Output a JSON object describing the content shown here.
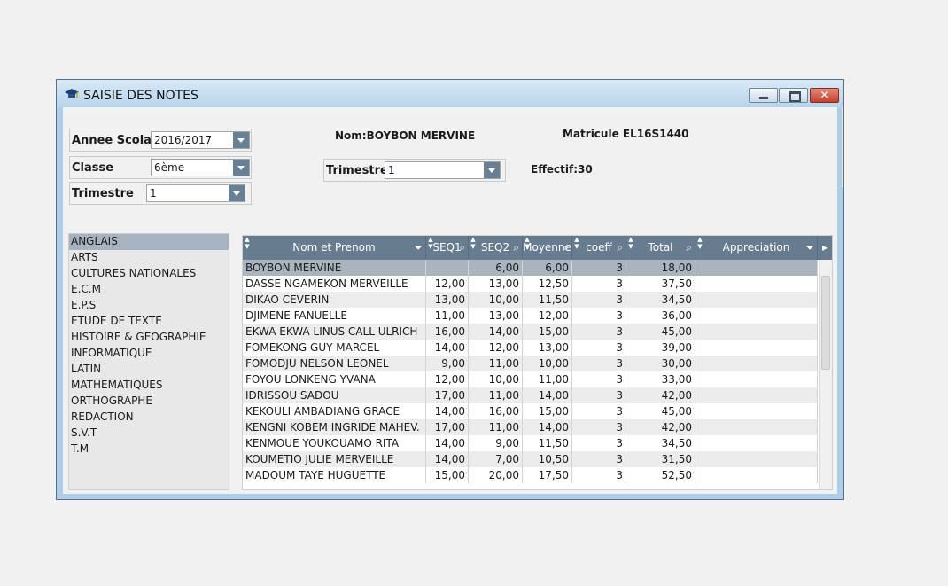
{
  "window": {
    "title": "SAISIE DES NOTES",
    "icon": "graduation-cap-icon",
    "close_glyph": "✕"
  },
  "form": {
    "annee": {
      "label": "Annee Scolair",
      "value": "2016/2017"
    },
    "classe": {
      "label": "Classe",
      "value": "6ème"
    },
    "trimestre_left": {
      "label": "Trimestre",
      "value": "1"
    },
    "trimestre_mid": {
      "label": "Trimestre",
      "value": "1"
    }
  },
  "student": {
    "nom_label": "Nom:",
    "nom": "BOYBON MERVINE",
    "matricule_label": "Matricule",
    "matricule": "EL16S1440",
    "effectif_label": "Effectif:",
    "effectif": "30"
  },
  "subjects": [
    "ANGLAIS",
    "ARTS",
    "CULTURES NATIONALES",
    "E.C.M",
    "E.P.S",
    "ETUDE DE TEXTE",
    "HISTOIRE & GEOGRAPHIE",
    "INFORMATIQUE",
    "LATIN",
    "MATHEMATIQUES",
    "ORTHOGRAPHE",
    "REDACTION",
    "S.V.T",
    "T.M"
  ],
  "selected_subject": "ANGLAIS",
  "grid": {
    "columns": [
      {
        "key": "nom",
        "label": "Nom et Prenom",
        "tool": "filter-icon"
      },
      {
        "key": "seq1",
        "label": "SEQ1",
        "tool": "search-icon"
      },
      {
        "key": "seq2",
        "label": "SEQ2",
        "tool": "search-icon"
      },
      {
        "key": "moy",
        "label": "Moyenne",
        "tool": "search-icon"
      },
      {
        "key": "coeff",
        "label": "coeff",
        "tool": "search-icon"
      },
      {
        "key": "total",
        "label": "Total",
        "tool": "search-icon"
      },
      {
        "key": "app",
        "label": "Appreciation",
        "tool": "filter-icon"
      }
    ],
    "rows": [
      [
        "BOYBON MERVINE",
        "",
        "6,00",
        "6,00",
        "3",
        "18,00",
        ""
      ],
      [
        "DASSE  NGAMEKON  MERVEILLE",
        "12,00",
        "13,00",
        "12,50",
        "3",
        "37,50",
        ""
      ],
      [
        "DIKAO  CEVERIN",
        "13,00",
        "10,00",
        "11,50",
        "3",
        "34,50",
        ""
      ],
      [
        "DJIMENE  FANUELLE",
        "11,00",
        "13,00",
        "12,00",
        "3",
        "36,00",
        ""
      ],
      [
        "EKWA  EKWA  LINUS  CALL  ULRICH",
        "16,00",
        "14,00",
        "15,00",
        "3",
        "45,00",
        ""
      ],
      [
        "FOMEKONG  GUY  MARCEL",
        "14,00",
        "12,00",
        "13,00",
        "3",
        "39,00",
        ""
      ],
      [
        "FOMODJU  NELSON  LEONEL",
        "9,00",
        "11,00",
        "10,00",
        "3",
        "30,00",
        ""
      ],
      [
        "FOYOU  LONKENG  YVANA",
        "12,00",
        "10,00",
        "11,00",
        "3",
        "33,00",
        ""
      ],
      [
        "IDRISSOU SADOU",
        "17,00",
        "11,00",
        "14,00",
        "3",
        "42,00",
        ""
      ],
      [
        "KEKOULI AMBADIANG GRACE",
        "14,00",
        "16,00",
        "15,00",
        "3",
        "45,00",
        ""
      ],
      [
        "KENGNI  KOBEM  INGRIDE  MAHEV.",
        "17,00",
        "11,00",
        "14,00",
        "3",
        "42,00",
        ""
      ],
      [
        "KENMOUE  YOUKOUAMO  RITA",
        "14,00",
        "9,00",
        "11,50",
        "3",
        "34,50",
        ""
      ],
      [
        "KOUMETIO  JULIE  MERVEILLE",
        "14,00",
        "7,00",
        "10,50",
        "3",
        "31,50",
        ""
      ],
      [
        "MADOUM  TAYE  HUGUETTE",
        "15,00",
        "20,00",
        "17,50",
        "3",
        "52,50",
        ""
      ]
    ]
  }
}
